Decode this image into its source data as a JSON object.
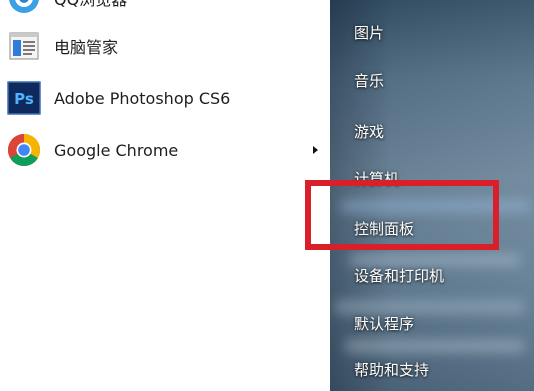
{
  "programs": [
    {
      "label": "QQ浏览器",
      "icon": "qq-browser-icon"
    },
    {
      "label": "电脑管家",
      "icon": "pc-manager-icon"
    },
    {
      "label": "Adobe Photoshop CS6",
      "icon": "photoshop-icon"
    },
    {
      "label": "Google Chrome",
      "icon": "chrome-icon",
      "has_submenu": true
    }
  ],
  "right_menu": [
    {
      "label": "图片"
    },
    {
      "label": "音乐"
    },
    {
      "label": "游戏"
    },
    {
      "label": "计算机"
    },
    {
      "label": "控制面板"
    },
    {
      "label": "设备和打印机"
    },
    {
      "label": "默认程序"
    },
    {
      "label": "帮助和支持"
    }
  ],
  "colors": {
    "highlight": "#d9202a",
    "photoshop_bg": "#0e2a5c",
    "photoshop_text": "#4fb3ff"
  },
  "photoshop_icon_text": "Ps"
}
